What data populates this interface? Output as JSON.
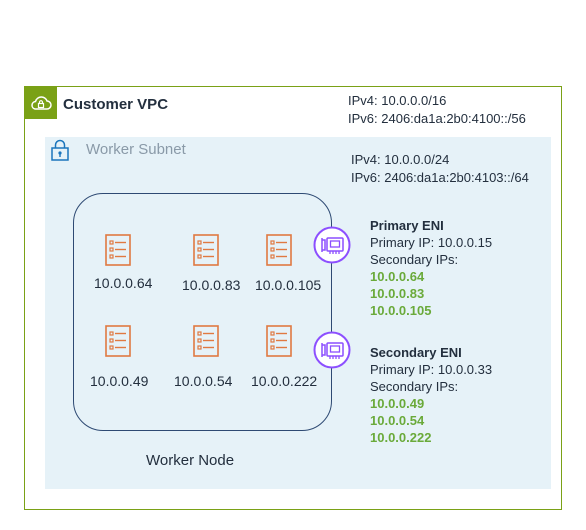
{
  "vpc": {
    "title": "Customer VPC",
    "ipv4": "IPv4: 10.0.0.0/16",
    "ipv6_prefix": "IPv6: ",
    "ipv6_value": "2406:da1a:2b0:4100::/56",
    "icon": "cloud-lock-icon",
    "border_color": "#7aa116"
  },
  "subnet": {
    "title": "Worker Subnet",
    "ipv4": "IPv4: 10.0.0.0/24",
    "ipv6_prefix": "IPv6: ",
    "ipv6_value": "2406:da1a:2b0:4103::/64",
    "icon": "lock-icon",
    "background": "#e6f2f8"
  },
  "worker_node": {
    "label": "Worker Node",
    "pods": [
      {
        "ip": "10.0.0.64"
      },
      {
        "ip": "10.0.0.83"
      },
      {
        "ip": "10.0.0.105"
      },
      {
        "ip": "10.0.0.49"
      },
      {
        "ip": "10.0.0.54"
      },
      {
        "ip": "10.0.0.222"
      }
    ],
    "pod_icon": "server-icon",
    "pod_color": "#e07941"
  },
  "enis": [
    {
      "title": "Primary ENI",
      "primary_ip": "Primary IP: 10.0.0.15",
      "secondary_label": "Secondary IPs:",
      "secondary_ips": [
        "10.0.0.64",
        "10.0.0.83",
        "10.0.0.105"
      ],
      "icon": "network-interface-icon"
    },
    {
      "title": "Secondary ENI",
      "primary_ip": "Primary IP: 10.0.0.33",
      "secondary_label": "Secondary IPs:",
      "secondary_ips": [
        "10.0.0.49",
        "10.0.0.54",
        "10.0.0.222"
      ],
      "icon": "network-interface-icon"
    }
  ],
  "colors": {
    "eni_accent": "#8c4fff",
    "secondary_ip_green": "#6aaa3a"
  }
}
